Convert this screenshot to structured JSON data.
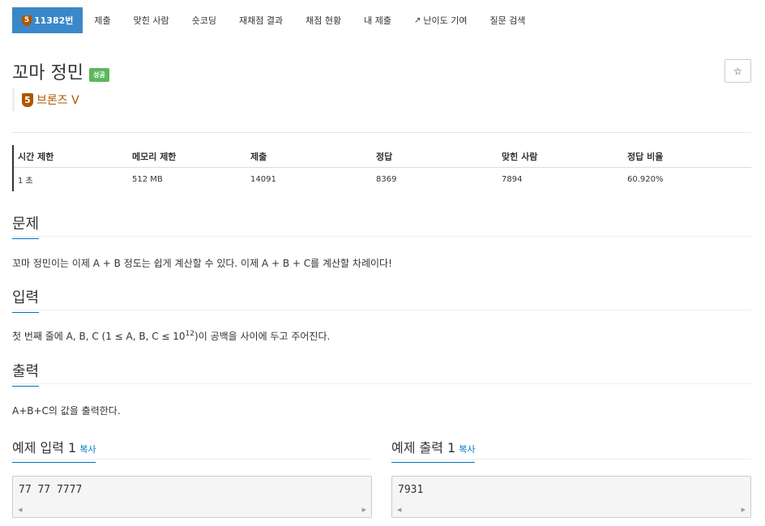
{
  "nav": {
    "problem_tier_glyph": "5",
    "problem_id_label": "11382번",
    "tabs": [
      {
        "label": "제출"
      },
      {
        "label": "맞힌 사람"
      },
      {
        "label": "숏코딩"
      },
      {
        "label": "재채점 결과"
      },
      {
        "label": "채점 현황"
      },
      {
        "label": "내 제출"
      },
      {
        "label": "난이도 기여"
      },
      {
        "label": "질문 검색"
      }
    ]
  },
  "problem": {
    "title": "꼬마 정민",
    "status_badge": "성공",
    "tier_glyph": "5",
    "tier_label": "브론즈 V",
    "tier_color": "#ad5600"
  },
  "info_table": {
    "headers": [
      "시간 제한",
      "메모리 제한",
      "제출",
      "정답",
      "맞힌 사람",
      "정답 비율"
    ],
    "values": [
      "1 초",
      "512 MB",
      "14091",
      "8369",
      "7894",
      "60.920%"
    ]
  },
  "sections": {
    "problem": {
      "title": "문제",
      "text": "꼬마 정민이는 이제 A + B 정도는 쉽게 계산할 수 있다. 이제 A + B + C를 계산할 차례이다!"
    },
    "input": {
      "title": "입력",
      "text_before": "첫 번째 줄에 A, B, C (1 ≤ A, B, C ≤ 10",
      "sup": "12",
      "text_after": ")이 공백을 사이에 두고 주어진다."
    },
    "output": {
      "title": "출력",
      "text": "A+B+C의 값을 출력한다."
    }
  },
  "samples": {
    "input": {
      "title": "예제 입력 1",
      "copy_label": "복사",
      "content": "77 77 7777"
    },
    "output": {
      "title": "예제 출력 1",
      "copy_label": "복사",
      "content": "7931"
    }
  },
  "colors": {
    "accent": "#3a87c9",
    "link": "#0076c0",
    "success": "#5cb85c",
    "bronze": "#ad5600"
  }
}
